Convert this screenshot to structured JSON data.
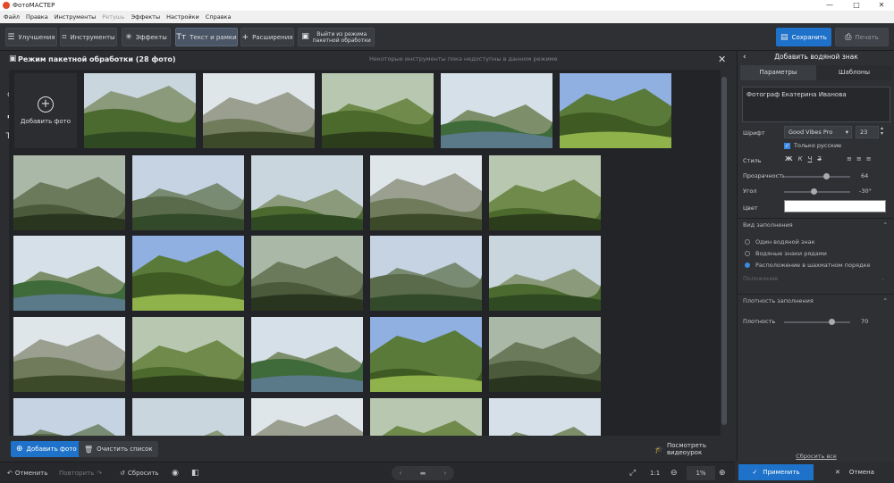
{
  "window": {
    "title": "ФотоМАСТЕР",
    "controls": [
      "—",
      "□",
      "✕"
    ]
  },
  "menu": [
    "Файл",
    "Правка",
    "Инструменты",
    "Ретушь",
    "Эффекты",
    "Настройки",
    "Справка"
  ],
  "toolbar": {
    "improve": "Улучшения",
    "tools": "Инструменты",
    "effects": "Эффекты",
    "text_frames": "Текст и рамки",
    "extensions": "Расширения",
    "exit_batch": [
      "Выйти из режима",
      "пакетной обработки"
    ],
    "save": "Сохранить",
    "print": "Печать"
  },
  "batch": {
    "title": "Режим пакетной обработки (28 фото)",
    "notice": "Некоторые инструменты пока недоступны в данном режиме",
    "add_photo_tile": "Добавить фото"
  },
  "watermark_text": "Фотограф Екатерина Иванова",
  "grid_bottom": {
    "add_photo": "Добавить фото",
    "clear_list": "Очистить список",
    "watch_video": "Посмотреть видеоурок"
  },
  "status": {
    "undo": "Отменить",
    "redo": "Повторить",
    "reset": "Сбросить",
    "ratio": "1:1",
    "zoom": "1%"
  },
  "panel": {
    "title": "Добавить водяной знак",
    "tab_params": "Параметры",
    "tab_templates": "Шаблоны",
    "text_value": "Фотограф Екатерина Иванова",
    "font_label": "Шрифт",
    "font_value": "Good Vibes Pro",
    "size_value": "23",
    "only_russian": "Только русские",
    "style_label": "Стиль",
    "opacity_label": "Прозрачность",
    "opacity_value": "64",
    "angle_label": "Угол",
    "angle_value": "-30°",
    "color_label": "Цвет",
    "fill_section": "Вид заполнения",
    "opt1": "Один водяной знак",
    "opt2": "Водяные знаки рядами",
    "opt3": "Расположение в шахматном порядке",
    "position_label": "Положение",
    "density_section": "Плотность заполнения",
    "density_label": "Плотность",
    "density_value": "70",
    "reset_all": "Сбросить все",
    "apply": "Применить",
    "cancel": "Отмена"
  }
}
